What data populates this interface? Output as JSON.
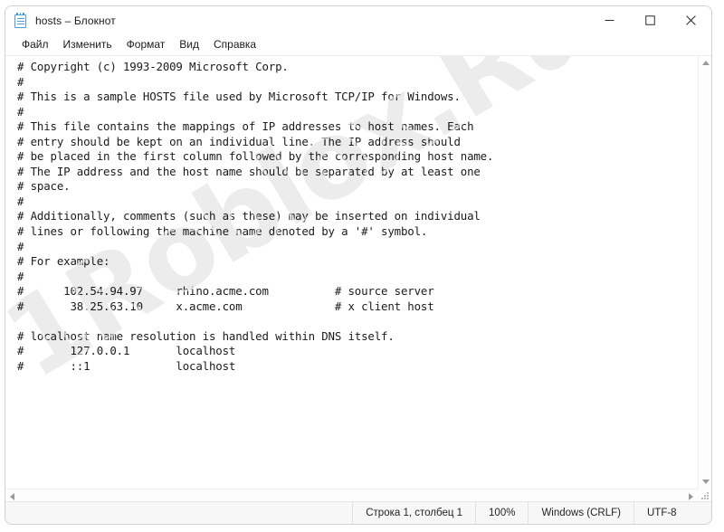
{
  "window": {
    "title": "hosts – Блокнот",
    "app_icon": "notepad-icon",
    "controls": {
      "minimize": "minimize-icon",
      "maximize": "maximize-icon",
      "close": "close-icon"
    }
  },
  "menu": {
    "items": [
      {
        "label": "Файл"
      },
      {
        "label": "Изменить"
      },
      {
        "label": "Формат"
      },
      {
        "label": "Вид"
      },
      {
        "label": "Справка"
      }
    ]
  },
  "editor": {
    "content": "# Copyright (c) 1993-2009 Microsoft Corp.\n#\n# This is a sample HOSTS file used by Microsoft TCP/IP for Windows.\n#\n# This file contains the mappings of IP addresses to host names. Each\n# entry should be kept on an individual line. The IP address should\n# be placed in the first column followed by the corresponding host name.\n# The IP address and the host name should be separated by at least one\n# space.\n#\n# Additionally, comments (such as these) may be inserted on individual\n# lines or following the machine name denoted by a '#' symbol.\n#\n# For example:\n#\n#      102.54.94.97     rhino.acme.com          # source server\n#       38.25.63.10     x.acme.com              # x client host\n\n# localhost name resolution is handled within DNS itself.\n#       127.0.0.1       localhost\n#       ::1             localhost"
  },
  "watermark": {
    "text": "1Roblox.Ru"
  },
  "scrollbars": {
    "vertical_up": "scroll-up-arrow-icon",
    "vertical_down": "scroll-down-arrow-icon",
    "horizontal_left": "scroll-left-arrow-icon",
    "horizontal_right": "scroll-right-arrow-icon"
  },
  "statusbar": {
    "position": "Строка 1, столбец 1",
    "zoom": "100%",
    "line_ending": "Windows (CRLF)",
    "encoding": "UTF-8"
  }
}
